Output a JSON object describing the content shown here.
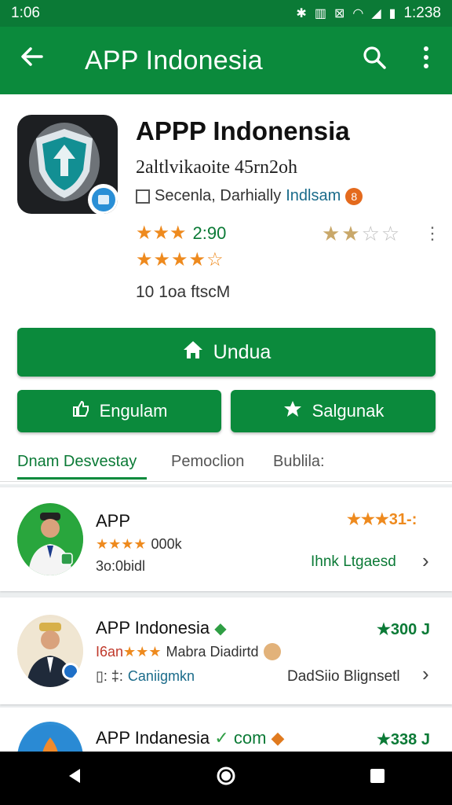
{
  "status": {
    "time_left": "1:06",
    "time_right": "1:238",
    "icons": [
      "bluetooth-icon",
      "vibrate-icon",
      "nfc-icon",
      "wifi-icon",
      "signal-icon",
      "battery-icon"
    ]
  },
  "appbar": {
    "title": "APP Indonesia",
    "back_icon": "back-arrow-icon",
    "search_icon": "search-icon",
    "more_icon": "more-vert-icon"
  },
  "app": {
    "title": "APPP Indonensia",
    "subtitle": "2altlvikaoite 45rn2oh",
    "developer": "Secenla, Darhially",
    "developer_link": "Indlsam",
    "developer_badge": "8",
    "rating_text": "2:90",
    "downloads": "10 1oa ftscM",
    "stars_row_a": "★★★",
    "stars_row_b": "★★★★☆",
    "stars_right_filled": "★★",
    "stars_right_empty": "☆☆"
  },
  "buttons": {
    "install": "Undua",
    "left": "Engulam",
    "right": "Salgunak"
  },
  "tabs": [
    {
      "label": "Dnam Desvestay"
    },
    {
      "label": "Pemoclion"
    },
    {
      "label": "Bublila:"
    }
  ],
  "list": [
    {
      "title": "APP",
      "stars": "★★★★",
      "meta": "000k",
      "sub": "3o:0bidl",
      "right_rating": "★★★31-:",
      "right_link": "Ihnk Ltgaesd"
    },
    {
      "title": "APP Indonesia",
      "stars_prefix": "I6an",
      "stars": "★★★",
      "meta": "Mabra Diadirtd",
      "sub": "Caniigmkn",
      "sub_prefix": "▯: ‡:",
      "right_rating": "★300 J",
      "right_link": "DadSiio Blignsetl"
    },
    {
      "title": "APP Indanesia",
      "title_suffix": "com",
      "right_rating": "★338 J"
    }
  ],
  "colors": {
    "primary": "#0b8a3c",
    "primary_dark": "#0b7a36",
    "star": "#ee8a1e"
  }
}
